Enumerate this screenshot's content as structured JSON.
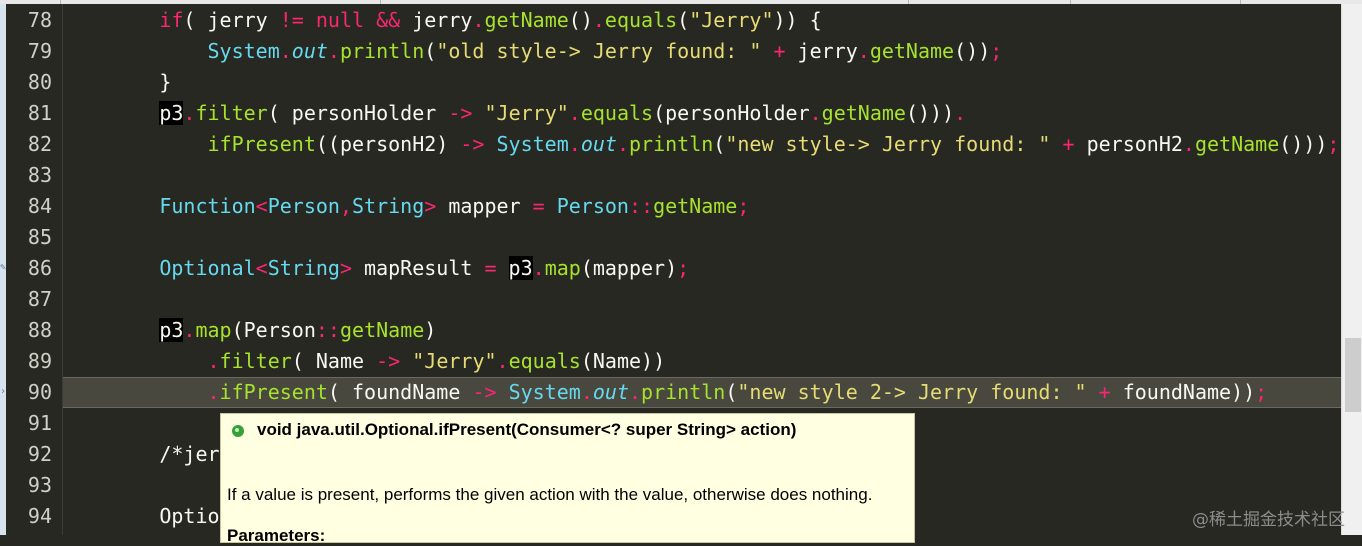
{
  "editor": {
    "line_numbers": [
      "78",
      "79",
      "80",
      "81",
      "82",
      "83",
      "84",
      "85",
      "86",
      "87",
      "88",
      "89",
      "90",
      "91",
      "92",
      "93",
      "94"
    ],
    "current_line": "90",
    "lines": [
      {
        "indent": "        ",
        "tokens": [
          [
            "kw",
            "if"
          ],
          [
            "",
            "( jerry "
          ],
          [
            "op",
            "!="
          ],
          [
            "",
            ""
          ],
          [
            "kw",
            " null"
          ],
          [
            "",
            ""
          ],
          [
            "op",
            " &&"
          ],
          [
            "",
            " jerry"
          ],
          [
            "op",
            "."
          ],
          [
            "fn",
            "getName"
          ],
          [
            "",
            "()"
          ],
          [
            "op",
            "."
          ],
          [
            "fn",
            "equals"
          ],
          [
            "",
            "("
          ],
          [
            "str",
            "\"Jerry\""
          ],
          [
            "",
            "))"
          ],
          [
            "",
            " {"
          ]
        ]
      },
      {
        "indent": "            ",
        "tokens": [
          [
            "ty",
            "System"
          ],
          [
            "op",
            "."
          ],
          [
            "it",
            "out"
          ],
          [
            "op",
            "."
          ],
          [
            "fn",
            "println"
          ],
          [
            "",
            "("
          ],
          [
            "str",
            "\"old style-> Jerry found: \""
          ],
          [
            "",
            " "
          ],
          [
            "op",
            "+"
          ],
          [
            "",
            " jerry"
          ],
          [
            "op",
            "."
          ],
          [
            "fn",
            "getName"
          ],
          [
            "",
            "())"
          ],
          [
            "op",
            ";"
          ]
        ]
      },
      {
        "indent": "        ",
        "tokens": [
          [
            "",
            "}"
          ]
        ]
      },
      {
        "indent": "        ",
        "tokens": [
          [
            "hl",
            "p3"
          ],
          [
            "op",
            "."
          ],
          [
            "fn",
            "filter"
          ],
          [
            "",
            "( personHolder "
          ],
          [
            "op",
            "->"
          ],
          [
            "",
            " "
          ],
          [
            "str",
            "\"Jerry\""
          ],
          [
            "op",
            "."
          ],
          [
            "fn",
            "equals"
          ],
          [
            "",
            "(personHolder"
          ],
          [
            "op",
            "."
          ],
          [
            "fn",
            "getName"
          ],
          [
            "",
            "()))"
          ],
          [
            "op",
            "."
          ]
        ]
      },
      {
        "indent": "            ",
        "tokens": [
          [
            "fn",
            "ifPresent"
          ],
          [
            "",
            "((personH2) "
          ],
          [
            "op",
            "->"
          ],
          [
            "",
            " "
          ],
          [
            "ty",
            "System"
          ],
          [
            "op",
            "."
          ],
          [
            "it",
            "out"
          ],
          [
            "op",
            "."
          ],
          [
            "fn",
            "println"
          ],
          [
            "",
            "("
          ],
          [
            "str",
            "\"new style-> Jerry found: \""
          ],
          [
            "",
            " "
          ],
          [
            "op",
            "+"
          ],
          [
            "",
            " personH2"
          ],
          [
            "op",
            "."
          ],
          [
            "fn",
            "getName"
          ],
          [
            "",
            "()))"
          ],
          [
            "op",
            ";"
          ]
        ]
      },
      {
        "indent": "",
        "tokens": []
      },
      {
        "indent": "        ",
        "tokens": [
          [
            "ty",
            "Function"
          ],
          [
            "op",
            "<"
          ],
          [
            "ty",
            "Person"
          ],
          [
            "op",
            ","
          ],
          [
            "ty",
            "String"
          ],
          [
            "op",
            ">"
          ],
          [
            "",
            " mapper "
          ],
          [
            "op",
            "="
          ],
          [
            "",
            " "
          ],
          [
            "ty",
            "Person"
          ],
          [
            "op",
            "::"
          ],
          [
            "fn",
            "getName"
          ],
          [
            "op",
            ";"
          ]
        ]
      },
      {
        "indent": "",
        "tokens": []
      },
      {
        "indent": "        ",
        "tokens": [
          [
            "ty",
            "Optional"
          ],
          [
            "op",
            "<"
          ],
          [
            "ty",
            "String"
          ],
          [
            "op",
            ">"
          ],
          [
            "",
            " mapResult "
          ],
          [
            "op",
            "="
          ],
          [
            "",
            " "
          ],
          [
            "hl",
            "p3"
          ],
          [
            "op",
            "."
          ],
          [
            "fn",
            "map"
          ],
          [
            "",
            "(mapper)"
          ],
          [
            "op",
            ";"
          ]
        ]
      },
      {
        "indent": "",
        "tokens": []
      },
      {
        "indent": "        ",
        "tokens": [
          [
            "hl",
            "p3"
          ],
          [
            "op",
            "."
          ],
          [
            "fn",
            "map"
          ],
          [
            "",
            "(Person"
          ],
          [
            "op",
            "::"
          ],
          [
            "fn",
            "getName"
          ],
          [
            "",
            ")"
          ]
        ]
      },
      {
        "indent": "            ",
        "tokens": [
          [
            "op",
            "."
          ],
          [
            "fn",
            "filter"
          ],
          [
            "",
            "( Name "
          ],
          [
            "op",
            "->"
          ],
          [
            "",
            " "
          ],
          [
            "str",
            "\"Jerry\""
          ],
          [
            "op",
            "."
          ],
          [
            "fn",
            "equals"
          ],
          [
            "",
            "(Name))"
          ]
        ]
      },
      {
        "indent": "            ",
        "tokens": [
          [
            "op",
            "."
          ],
          [
            "fn",
            "ifPresent"
          ],
          [
            "",
            "( foundName "
          ],
          [
            "op",
            "->"
          ],
          [
            "",
            " "
          ],
          [
            "ty",
            "System"
          ],
          [
            "op",
            "."
          ],
          [
            "it",
            "out"
          ],
          [
            "op",
            "."
          ],
          [
            "fn",
            "println"
          ],
          [
            "",
            "("
          ],
          [
            "str",
            "\"new style 2-> Jerry found: \""
          ],
          [
            "",
            " "
          ],
          [
            "op",
            "+"
          ],
          [
            "",
            " foundName))"
          ],
          [
            "op",
            ";"
          ]
        ]
      },
      {
        "indent": "",
        "tokens": []
      },
      {
        "indent": "        ",
        "tokens": [
          [
            "",
            "/*jer"
          ]
        ]
      },
      {
        "indent": "",
        "tokens": []
      },
      {
        "indent": "        ",
        "tokens": [
          [
            "",
            "Optio"
          ]
        ]
      }
    ]
  },
  "tooltip": {
    "signature": "void java.util.Optional.ifPresent(Consumer<? super String> action)",
    "description": "If a value is present, performs the given action with the value, otherwise does nothing.",
    "params_heading": "Parameters:"
  },
  "watermark": "@稀土掘金技术社区",
  "colors": {
    "background": "#272822",
    "keyword": "#f92672",
    "function": "#a6e22e",
    "type": "#66d9ef",
    "string": "#e6db74",
    "tooltip_bg": "#ffffe1"
  }
}
